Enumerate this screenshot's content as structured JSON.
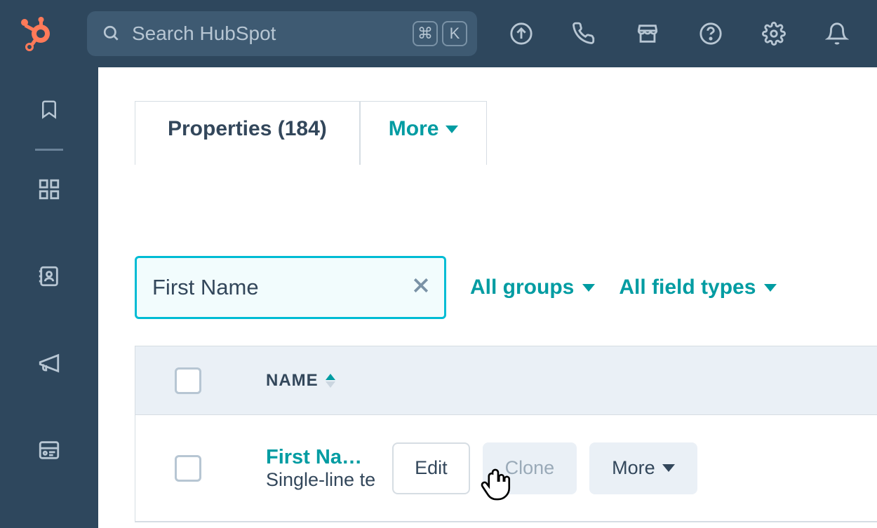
{
  "topbar": {
    "search_placeholder": "Search HubSpot",
    "kbd1": "⌘",
    "kbd2": "K"
  },
  "tabs": {
    "properties_label": "Properties (184)",
    "more_label": "More"
  },
  "filters": {
    "search_value": "First Name",
    "groups_label": "All groups",
    "field_types_label": "All field types"
  },
  "table": {
    "header_name": "NAME",
    "rows": [
      {
        "name_label": "First Na…",
        "type_label": "Single-line te",
        "edit_label": "Edit",
        "clone_label": "Clone",
        "more_label": "More"
      }
    ]
  }
}
